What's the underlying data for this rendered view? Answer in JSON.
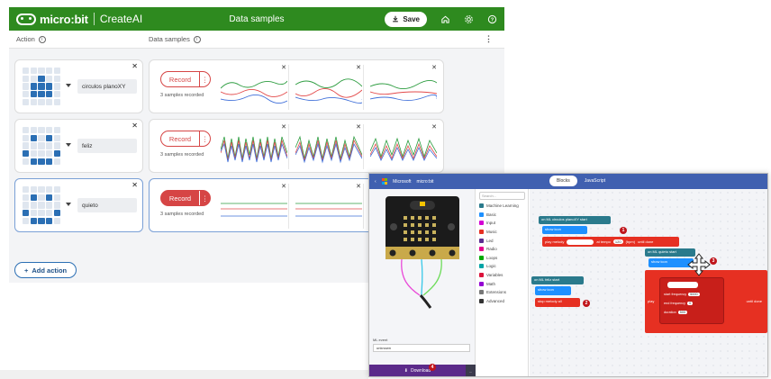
{
  "app": {
    "brand": "micro:bit",
    "subbrand": "CreateAI",
    "title": "Data samples",
    "save_label": "Save"
  },
  "headers": {
    "action": "Action",
    "data_samples": "Data samples"
  },
  "rows": [
    {
      "name": "circulos planoXY",
      "record_label": "Record",
      "samples_text": "3 samples recorded",
      "leds": [
        0,
        0,
        0,
        0,
        0,
        0,
        0,
        1,
        0,
        0,
        0,
        1,
        1,
        1,
        0,
        0,
        1,
        1,
        1,
        0,
        0,
        0,
        0,
        0,
        0
      ]
    },
    {
      "name": "feliz",
      "record_label": "Record",
      "samples_text": "3 samples recorded",
      "leds": [
        0,
        0,
        0,
        0,
        0,
        0,
        1,
        0,
        1,
        0,
        0,
        0,
        0,
        0,
        0,
        1,
        0,
        0,
        0,
        1,
        0,
        1,
        1,
        1,
        0
      ]
    },
    {
      "name": "quieto",
      "record_label": "Record",
      "samples_text": "3 samples recorded",
      "leds": [
        0,
        0,
        0,
        0,
        0,
        0,
        1,
        0,
        1,
        0,
        0,
        0,
        0,
        0,
        0,
        1,
        0,
        0,
        0,
        1,
        0,
        1,
        1,
        1,
        0
      ]
    }
  ],
  "add_action_label": "Add action",
  "colors": {
    "topbar": "#2e8a1f",
    "record": "#d64545",
    "accent": "#2b6fb4"
  },
  "makecode": {
    "brand": "Microsoft",
    "project": "micro:bit",
    "tab_blocks": "Blocks",
    "tab_js": "JavaScript",
    "search_placeholder": "Search...",
    "categories": [
      {
        "label": "Machine Learning",
        "color": "#2a7a8c"
      },
      {
        "label": "Basic",
        "color": "#1e90ff"
      },
      {
        "label": "Input",
        "color": "#d400d4"
      },
      {
        "label": "Music",
        "color": "#e63022"
      },
      {
        "label": "Led",
        "color": "#5c2d91"
      },
      {
        "label": "Radio",
        "color": "#e3008c"
      },
      {
        "label": "Loops",
        "color": "#00aa00"
      },
      {
        "label": "Logic",
        "color": "#00a4a6"
      },
      {
        "label": "Variables",
        "color": "#dc143c"
      },
      {
        "label": "Math",
        "color": "#9400d3"
      },
      {
        "label": "Extensions",
        "color": "#777777"
      },
      {
        "label": "Advanced",
        "color": "#333333"
      }
    ],
    "ml_event_label": "ML event",
    "ml_event_value": "unknown",
    "download_label": "Download",
    "blocks": {
      "on_ml_circulos": "on ML circulos planoXY start",
      "show_icon": "show icon",
      "play_melody": "play melody",
      "at_tempo": "at tempo",
      "tempo_value": "120",
      "bpm": "(bpm)",
      "until_done": "until done",
      "on_ml_feliz": "on ML feliz start",
      "on_ml_quieto": "on ML quieto start",
      "stop_melody": "stop melody all",
      "start_frequency": "start frequency",
      "start_frequency_value": "5000",
      "end_frequency": "end frequency",
      "end_frequency_value": "0",
      "duration": "duration",
      "duration_value": "500",
      "play": "play"
    },
    "badges": [
      "1",
      "2",
      "3",
      "4"
    ]
  }
}
